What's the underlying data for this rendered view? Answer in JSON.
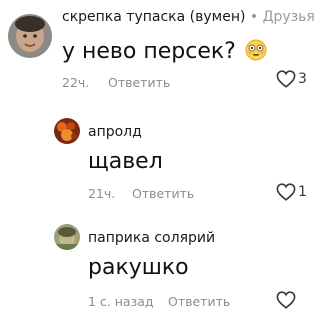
{
  "comments": [
    {
      "author": "скрепка тупаска (вумен)",
      "badge": "Друзья",
      "text": "у нево персек?",
      "emoji": "flushed-face-emoji",
      "time": "22ч.",
      "reply_label": "Ответить",
      "likes": "3"
    },
    {
      "author": "апролд",
      "text": "щавел",
      "time": "21ч.",
      "reply_label": "Ответить",
      "likes": "1"
    },
    {
      "author": "паприка солярий",
      "text": "ракушко",
      "time": "1 с. назад",
      "reply_label": "Ответить",
      "likes": ""
    }
  ],
  "colors": {
    "meta_text": "#8c8c8c",
    "heart_outline": "#3a3a3a"
  }
}
